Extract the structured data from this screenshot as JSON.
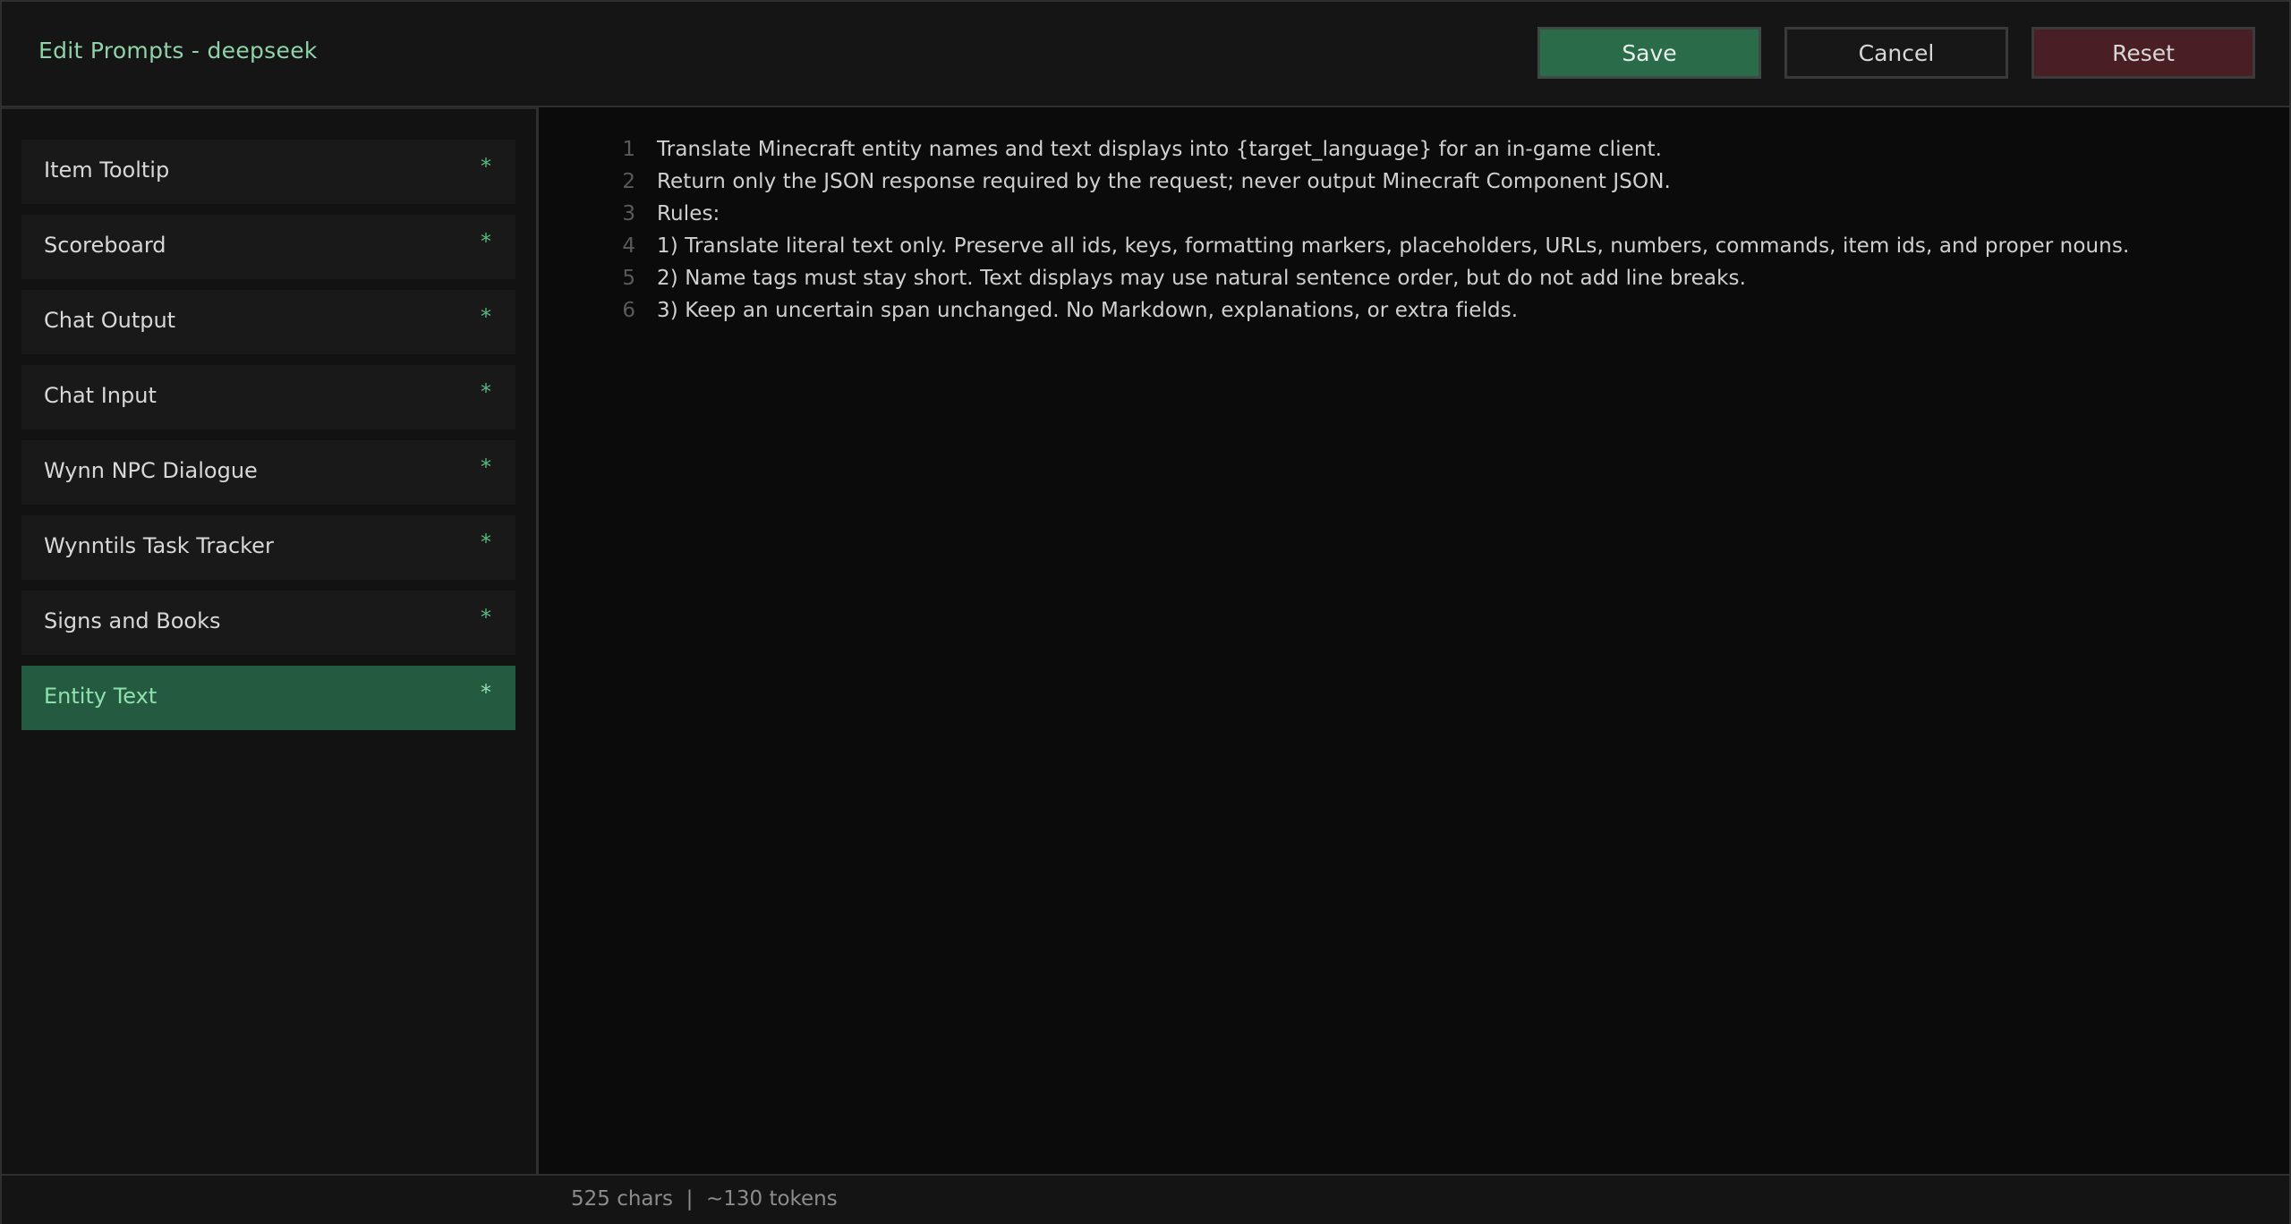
{
  "header": {
    "title": "Edit Prompts - deepseek",
    "buttons": {
      "save": "Save",
      "cancel": "Cancel",
      "reset": "Reset"
    }
  },
  "sidebar": {
    "items": [
      {
        "label": "Item Tooltip",
        "marker": "*"
      },
      {
        "label": "Scoreboard",
        "marker": "*"
      },
      {
        "label": "Chat Output",
        "marker": "*"
      },
      {
        "label": "Chat Input",
        "marker": "*"
      },
      {
        "label": "Wynn NPC Dialogue",
        "marker": "*"
      },
      {
        "label": "Wynntils Task Tracker",
        "marker": "*"
      },
      {
        "label": "Signs and Books",
        "marker": "*"
      },
      {
        "label": "Entity Text",
        "marker": "*"
      }
    ],
    "active_index": 7
  },
  "editor": {
    "lines": [
      {
        "num": "1",
        "text": "Translate Minecraft entity names and text displays into {target_language} for an in-game client."
      },
      {
        "num": "2",
        "text": "Return only the JSON response required by the request; never output Minecraft Component JSON."
      },
      {
        "num": "3",
        "text": "Rules:"
      },
      {
        "num": "4",
        "text": "1) Translate literal text only. Preserve all ids, keys, formatting markers, placeholders, URLs, numbers, commands, item ids, and proper nouns."
      },
      {
        "num": "5",
        "text": "2) Name tags must stay short. Text displays may use natural sentence order, but do not add line breaks."
      },
      {
        "num": "6",
        "text": "3) Keep an uncertain span unchanged. No Markdown, explanations, or extra fields."
      }
    ]
  },
  "footer": {
    "status": "525 chars  |  ~130 tokens"
  },
  "colors": {
    "accent": "#8fd4a8",
    "save": "#2a6b4a",
    "reset": "#4a1f24",
    "active_item": "#245a3f"
  }
}
